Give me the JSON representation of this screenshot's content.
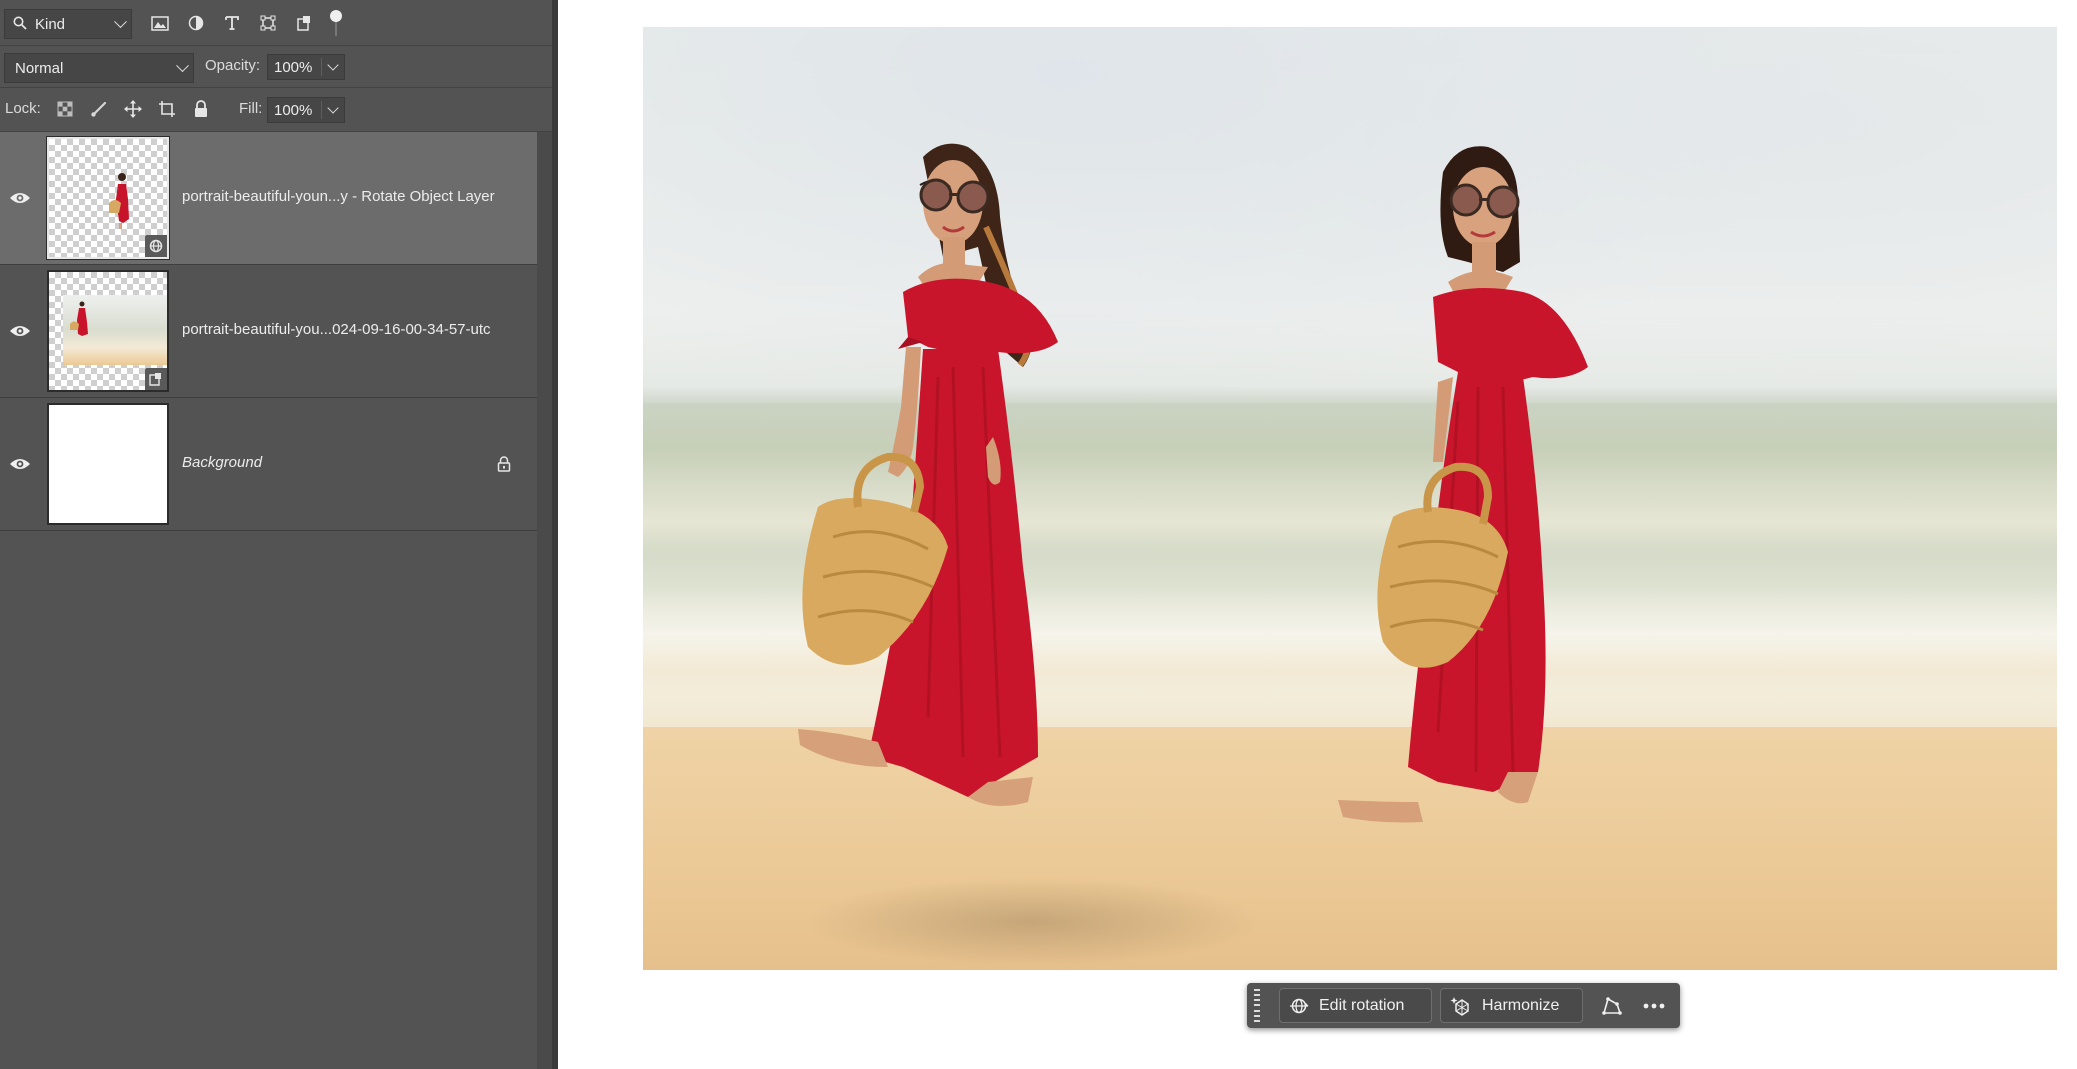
{
  "layers_panel": {
    "filter": {
      "kind_label": "Kind"
    },
    "blend_mode": "Normal",
    "opacity_label": "Opacity:",
    "opacity_value": "100%",
    "lock_label": "Lock:",
    "fill_label": "Fill:",
    "fill_value": "100%",
    "layers": [
      {
        "name": "portrait-beautiful-youn...y - Rotate Object Layer",
        "visible": true,
        "selected": true,
        "badge": "rotate-object-icon"
      },
      {
        "name": "portrait-beautiful-you...024-09-16-00-34-57-utc",
        "visible": true,
        "selected": false,
        "badge": "smart-object-icon"
      },
      {
        "name": "Background",
        "visible": true,
        "selected": false,
        "locked": true
      }
    ]
  },
  "taskbar": {
    "edit_rotation_label": "Edit rotation",
    "harmonize_label": "Harmonize"
  },
  "colors": {
    "panel_bg": "#535353",
    "selected_layer_bg": "#6c6c6c",
    "dress_red": "#c8142a"
  }
}
